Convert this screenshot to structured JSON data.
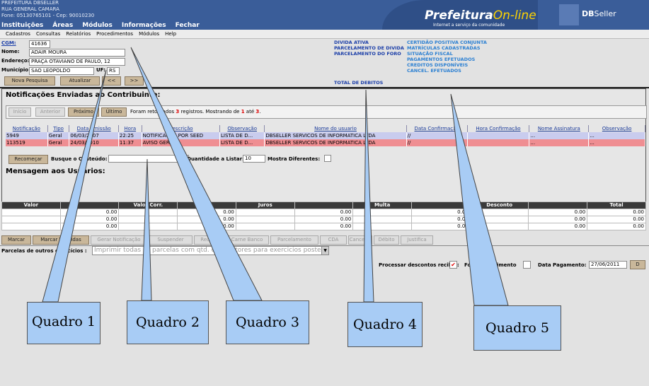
{
  "header": {
    "org_lines": [
      "PREFEITURA DBSELLER",
      "RUA GENERAL CAMARA",
      "Fone: 05130765101  -  Cep: 90010230"
    ],
    "top_nav": [
      "Instituições",
      "Áreas",
      "Módulos",
      "Informações",
      "Fechar"
    ],
    "logo_main": "Prefeitura",
    "logo_suffix": "On-line",
    "logo_sub": "Internet a serviço da comunidade",
    "brand_prefix": "DB",
    "brand_suffix": "Seller"
  },
  "menu": [
    "Cadastros",
    "Consultas",
    "Relatórios",
    "Procedimentos",
    "Módulos",
    "Help"
  ],
  "form": {
    "cgm_label": "CGM:",
    "cgm_value": "41636",
    "nome_label": "Nome:",
    "nome_value": "ADAIR MOURA",
    "endereco_label": "Endereço:",
    "endereco_value": "PRAÇA OTAVIANO DE PAULO, 12",
    "municipio_label": "Município:",
    "municipio_value": "SÃO LEOPOLDO",
    "uf_label": "UF:",
    "uf_value": "RS",
    "btn_nova": "Nova Pesquisa",
    "btn_atualizar": "Atualizar",
    "btn_prev": "<<",
    "btn_next": ">>"
  },
  "links_left": [
    "DIVIDA ATIVA",
    "PARCELAMENTO DE DIVIDA",
    "PARCELAMENTO DO FORO"
  ],
  "links_right": [
    "CERTIDÃO POSITIVA CONJUNTA",
    "MATRÍCULAS CADASTRADAS",
    "SITUAÇÃO FISCAL",
    "PAGAMENTOS EFETUADOS",
    "CREDITOS DISPONÍVEIS",
    "CANCEL. EFETUADOS"
  ],
  "total_debitos": "TOTAL DE DEBITOS",
  "notif": {
    "title": "Notificações Enviadas ao Contribuinte:",
    "nav": [
      "Início",
      "Anterior",
      "Próximo",
      "Último"
    ],
    "status_pre": "Foram retornados ",
    "status_count": "3",
    "status_mid": " registros. Mostrando de ",
    "status_from": "1",
    "status_to_word": " até ",
    "status_to": "3",
    "columns": [
      "Notificação",
      "Tipo",
      "Data Emissão",
      "Hora",
      "Descrição",
      "Observação",
      "Nome do usuario",
      "Data Confirmação",
      "Hora Confirmação",
      "Nome Assinatura",
      "Observação"
    ],
    "rows": [
      [
        "5949",
        "Geral",
        "06/03/2007",
        "22:25",
        "NOTIFICAÇÃO POR SEED",
        "LISTA DE D...",
        "DBSELLER SERVICOS DE INFORMATICA LTDA",
        "//",
        "",
        "...",
        "..."
      ],
      [
        "113519",
        "Geral",
        "24/03/2010",
        "11:37",
        "AVISO GERAL",
        "LISTA DE D...",
        "DBSELLER SERVICOS DE INFORMATICA LTDA",
        "//",
        "",
        "...",
        "..."
      ]
    ],
    "btn_recomecar": "Recomeçar",
    "busque_label": "Busque o Conteúdo:",
    "qtd_label": "Quantidade a Listar:",
    "qtd_value": "10",
    "mostra_label": "Mostra Diferentes:"
  },
  "mensagem_title": "Mensagem aos Usuários:",
  "totals": {
    "headers": [
      "Valor",
      "",
      "Valor Corr.",
      "",
      "Juros",
      "",
      "Multa",
      "",
      "Desconto",
      "",
      "Total"
    ],
    "rows": [
      [
        "",
        "0.00",
        "",
        "0.00",
        "",
        "0.00",
        "",
        "0.00",
        "",
        "0.00",
        "0.00"
      ],
      [
        "",
        "0.00",
        "",
        "0.00",
        "",
        "0.00",
        "",
        "0.00",
        "",
        "0.00",
        "0.00"
      ],
      [
        "",
        "0.00",
        "",
        "0.00",
        "",
        "0.00",
        "",
        "0.00",
        "",
        "0.00",
        "0.00"
      ]
    ]
  },
  "actions": [
    "Marcar",
    "Marcar Vencidas",
    "Gerar Notificação",
    "Suspender",
    "Recibo",
    "Carne Banco",
    "Parcelamento",
    "CDA",
    "Cancelar",
    "Débito",
    "Justifica"
  ],
  "parcelas_label": "Parcelas de outros exercícios :",
  "parcelas_select": "Imprimir todas as parcelas com qtd. de Inflatores para exercicios posteriores",
  "footer": {
    "processar_label": "Processar descontos recibo :",
    "forcar_label": "Forçar vencimento",
    "data_label": "Data Pagamento:",
    "data_value": "27/06/2011",
    "d_btn": "D"
  },
  "callouts": [
    "Quadro 1",
    "Quadro 2",
    "Quadro 3",
    "Quadro 4",
    "Quadro 5"
  ],
  "colors": {
    "header_bg": "#3a5d99",
    "row_blue": "#c9ccee",
    "row_red": "#ef8e92",
    "callout": "#a8ccf5"
  }
}
